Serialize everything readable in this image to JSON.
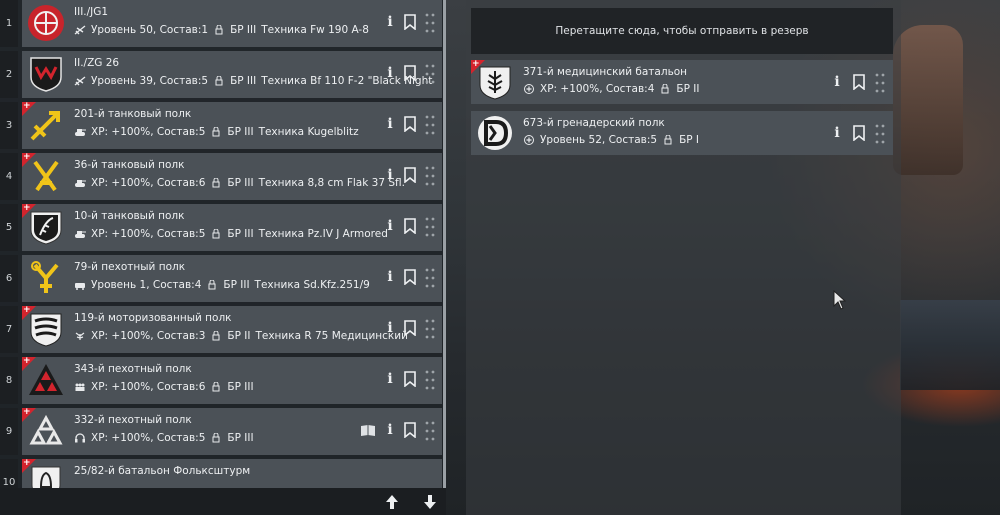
{
  "colors": {
    "card": "#4b5157",
    "badge": "#d3242d",
    "panel": "#202428"
  },
  "list": {
    "rows": [
      {
        "num": "1",
        "title": "III./JG1",
        "icon": "plane-icon",
        "info": "Уровень 50, Состав:1",
        "br": "БР III",
        "tech": "Техника Fw 190 A-8",
        "badge": false
      },
      {
        "num": "2",
        "title": "II./ZG 26",
        "icon": "plane-icon",
        "info": "Уровень 39, Состав:5",
        "br": "БР III",
        "tech": "Техника Bf 110 F-2 \"Black Night",
        "badge": false
      },
      {
        "num": "3",
        "title": "201-й танковый полк",
        "icon": "tank-icon",
        "info": "XP: +100%, Состав:5",
        "br": "БР III",
        "tech": "Техника Kugelblitz",
        "badge": true
      },
      {
        "num": "4",
        "title": "36-й танковый полк",
        "icon": "tank-icon",
        "info": "XP: +100%, Состав:6",
        "br": "БР III",
        "tech": "Техника 8,8 cm Flak 37 Sfl.",
        "badge": true
      },
      {
        "num": "5",
        "title": "10-й танковый полк",
        "icon": "tank-icon",
        "info": "XP: +100%, Состав:5",
        "br": "БР III",
        "tech": "Техника Pz.IV J Armored",
        "badge": true
      },
      {
        "num": "6",
        "title": "79-й пехотный полк",
        "icon": "car-icon",
        "info": "Уровень 1, Состав:4",
        "br": "БР III",
        "tech": "Техника Sd.Kfz.251/9",
        "badge": false
      },
      {
        "num": "7",
        "title": "119-й моторизованный полк",
        "icon": "radio-icon",
        "info": "XP: +100%, Состав:3",
        "br": "БР II",
        "tech": "Техника R 75 Медицинский",
        "badge": true
      },
      {
        "num": "8",
        "title": "343-й пехотный полк",
        "icon": "infantry-icon",
        "info": "XP: +100%, Состав:6",
        "br": "БР III",
        "tech": "",
        "badge": true
      },
      {
        "num": "9",
        "title": "332-й пехотный полк",
        "icon": "headset-icon",
        "info": "XP: +100%, Состав:5",
        "br": "БР III",
        "tech": "",
        "badge": true
      },
      {
        "num": "10",
        "title": "25/82-й батальон Фольксштурм",
        "icon": "infantry-icon",
        "info": "",
        "br": "",
        "tech": "",
        "badge": true
      }
    ]
  },
  "reserve": {
    "dropzone": "Перетащите сюда, чтобы отправить в резерв",
    "rows": [
      {
        "title": "371-й медицинский батальон",
        "info": "XP: +100%, Состав:4",
        "br": "БР II",
        "badge": true
      },
      {
        "title": "673-й гренадерский полк",
        "info": "Уровень 52, Состав:5",
        "br": "БР I",
        "badge": false
      }
    ]
  },
  "buttons": {
    "info_label": "i",
    "badge_plus": "+"
  }
}
